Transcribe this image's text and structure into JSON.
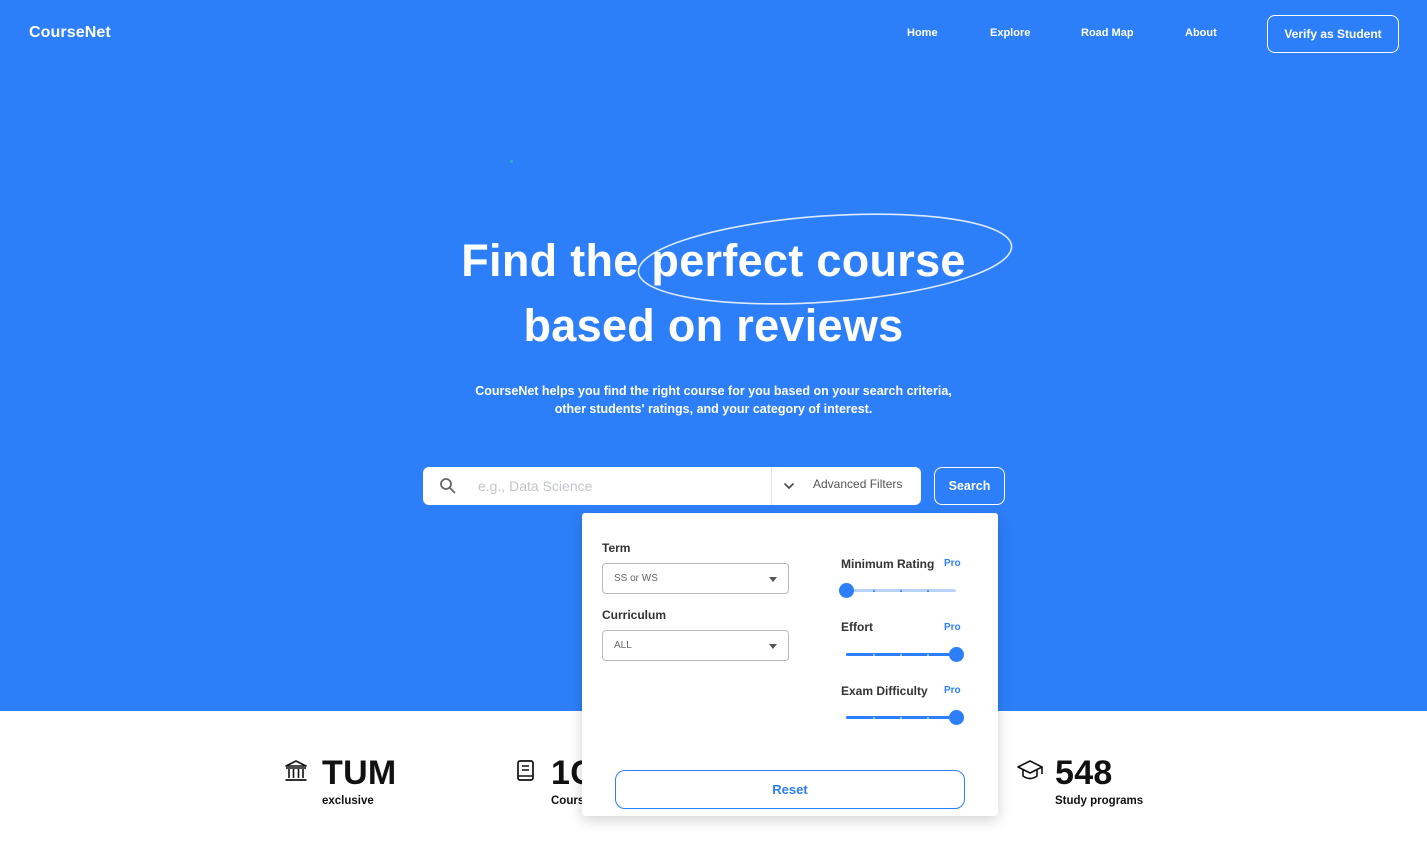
{
  "header": {
    "brand": "CourseNet",
    "nav": [
      "Home",
      "Explore",
      "Road Map",
      "About"
    ],
    "verify_label": "Verify as Student"
  },
  "hero": {
    "headline_line1": "Find the perfect course",
    "headline_line2": "based on reviews",
    "subtext_line1": "CourseNet helps you find the right course for you based on your search criteria,",
    "subtext_line2": "other students' ratings, and your category of interest."
  },
  "search": {
    "placeholder": "e.g., Data Science",
    "value": "",
    "advanced_label": "Advanced Filters",
    "button_label": "Search"
  },
  "filters": {
    "term_label": "Term",
    "term_value": "SS or WS",
    "curriculum_label": "Curriculum",
    "curriculum_value": "ALL",
    "pro_badge": "Pro",
    "sliders": [
      {
        "label": "Minimum Rating",
        "level": 0
      },
      {
        "label": "Effort",
        "level": 1
      },
      {
        "label": "Exam Difficulty",
        "level": 1
      }
    ],
    "reset_label": "Reset"
  },
  "stats": [
    {
      "value": "TUM",
      "label": "exclusive",
      "icon": "institution-icon"
    },
    {
      "value": "1C",
      "label": "Cours",
      "icon": "book-icon"
    },
    {
      "value": "548",
      "label": "Study programs",
      "icon": "graduation-cap-icon"
    }
  ],
  "colors": {
    "primary": "#2d7ff9",
    "track_light": "#b8d3fc",
    "text_dark": "#111111"
  }
}
